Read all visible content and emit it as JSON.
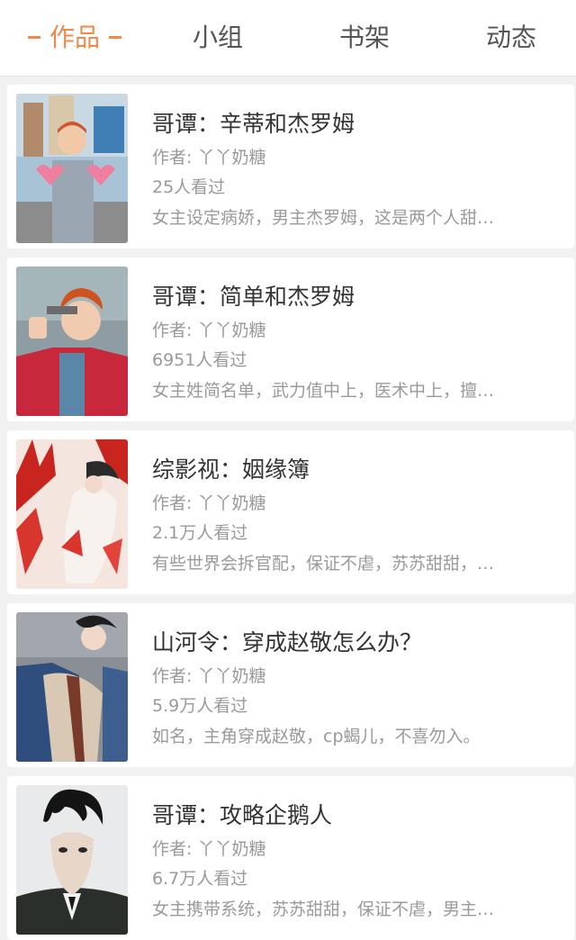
{
  "tabs": [
    {
      "label": "作品",
      "active": true
    },
    {
      "label": "小组",
      "active": false
    },
    {
      "label": "书架",
      "active": false
    },
    {
      "label": "动态",
      "active": false
    }
  ],
  "colors": {
    "accent": "#f08a4b",
    "background": "#f1f1f1",
    "card": "#ffffff",
    "title_text": "#333333",
    "meta_text": "#9a9a9a"
  },
  "works": [
    {
      "title": "哥谭：辛蒂和杰罗姆",
      "author": "作者: 丫丫奶糖",
      "views": "25人看过",
      "desc": "女主设定病娇，男主杰罗姆，这是两个人甜…",
      "cover": "cover-image-red-haired-boy-with-hearts"
    },
    {
      "title": "哥谭：简单和杰罗姆",
      "author": "作者: 丫丫奶糖",
      "views": "6951人看过",
      "desc": "女主姓简名单，武力值中上，医术中上，擅…",
      "cover": "cover-image-red-haired-man-with-gun"
    },
    {
      "title": "综影视：姻缘簿",
      "author": "作者: 丫丫奶糖",
      "views": "2.1万人看过",
      "desc": "有些世界会拆官配，保证不虐，苏苏甜甜，…",
      "cover": "cover-image-red-spider-lily-illustration"
    },
    {
      "title": "山河令：穿成赵敬怎么办？",
      "author": "作者: 丫丫奶糖",
      "views": "5.9万人看过",
      "desc": "如名，主角穿成赵敬，cp蝎儿，不喜勿入。",
      "cover": "cover-image-costumed-figure-lying-down"
    },
    {
      "title": "哥谭：攻略企鹅人",
      "author": "作者: 丫丫奶糖",
      "views": "6.7万人看过",
      "desc": "女主携带系统，苏苏甜甜，保证不虐，男主…",
      "cover": "cover-image-dark-haired-man-portrait"
    }
  ]
}
